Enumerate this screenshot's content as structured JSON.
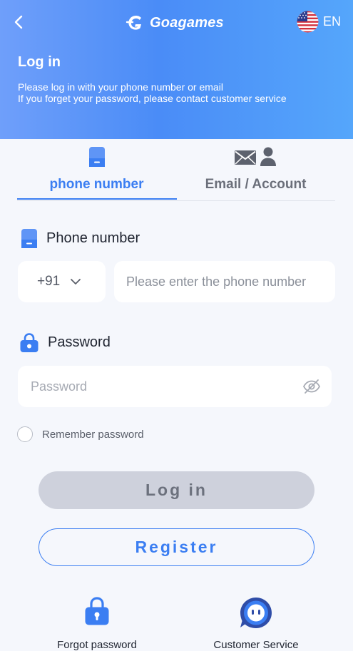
{
  "header": {
    "brand": "Goagames",
    "language": "EN",
    "title": "Log in",
    "desc_line1": "Please log in with your phone number or email",
    "desc_line2": "If you forget your password, please contact customer service"
  },
  "tabs": [
    {
      "label": "phone number",
      "icon": "phone-icon",
      "active": true
    },
    {
      "label": "Email / Account",
      "icon": "mail-user-icon",
      "active": false
    }
  ],
  "phone_field": {
    "label": "Phone number",
    "country_code": "+91",
    "placeholder": "Please enter the phone number",
    "value": ""
  },
  "password_field": {
    "label": "Password",
    "placeholder": "Password",
    "value": ""
  },
  "remember": {
    "label": "Remember password",
    "checked": false
  },
  "buttons": {
    "login": "Log in",
    "register": "Register"
  },
  "bottom": {
    "forgot": "Forgot password",
    "service": "Customer Service"
  },
  "colors": {
    "accent": "#3b7ef2",
    "header_start": "#6f9ffa",
    "header_end": "#55a6fb",
    "background": "#f5f7fc",
    "login_disabled": "#ced1dc"
  }
}
